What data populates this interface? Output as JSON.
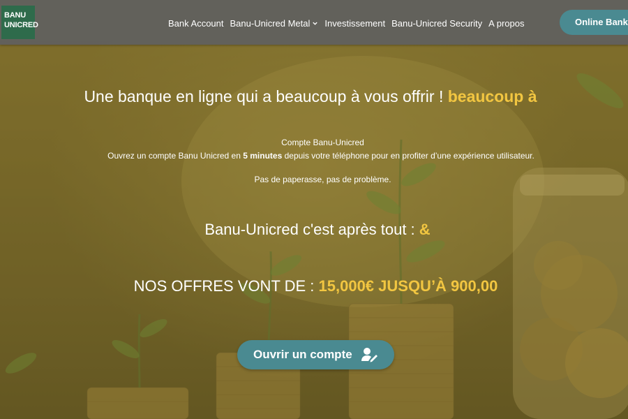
{
  "logo": {
    "line1": "BANU",
    "line2": "UNICRED"
  },
  "nav": {
    "items": [
      {
        "label": "Bank Account"
      },
      {
        "label": "Banu-Unicred Metal"
      },
      {
        "label": "Investissement"
      },
      {
        "label": "Banu-Unicred Security"
      },
      {
        "label": "A propos"
      }
    ],
    "online_button": "Online Banking"
  },
  "hero": {
    "headline": "Une banque en ligne qui a beaucoup à vous offrir !",
    "headline_accent": "beaucoup à",
    "sub_title": "Compte Banu-Unicred",
    "sub_text_before": "Ouvrez un compte Banu Unicred en",
    "sub_text_bold": "5 minutes",
    "sub_text_after": "depuis votre téléphone pour en profiter d’une expérience utilisateur.",
    "sub_note": "Pas de paperasse, pas de problème.",
    "tagline": "Banu-Unicred c'est après tout :",
    "tagline_accent": "&",
    "offers": "NOS OFFRES VONT DE :",
    "offers_accent": "15,000€ JUSQU’À 900,00",
    "cta_label": "Ouvrir un compte"
  },
  "colors": {
    "accent": "#f2c641",
    "button": "#4a8a91",
    "logo_bg": "#2e6b4b",
    "navbar": "#5f5f5f"
  },
  "icons": {
    "chevron": "chevron-down-icon",
    "cta": "user-edit-icon"
  }
}
